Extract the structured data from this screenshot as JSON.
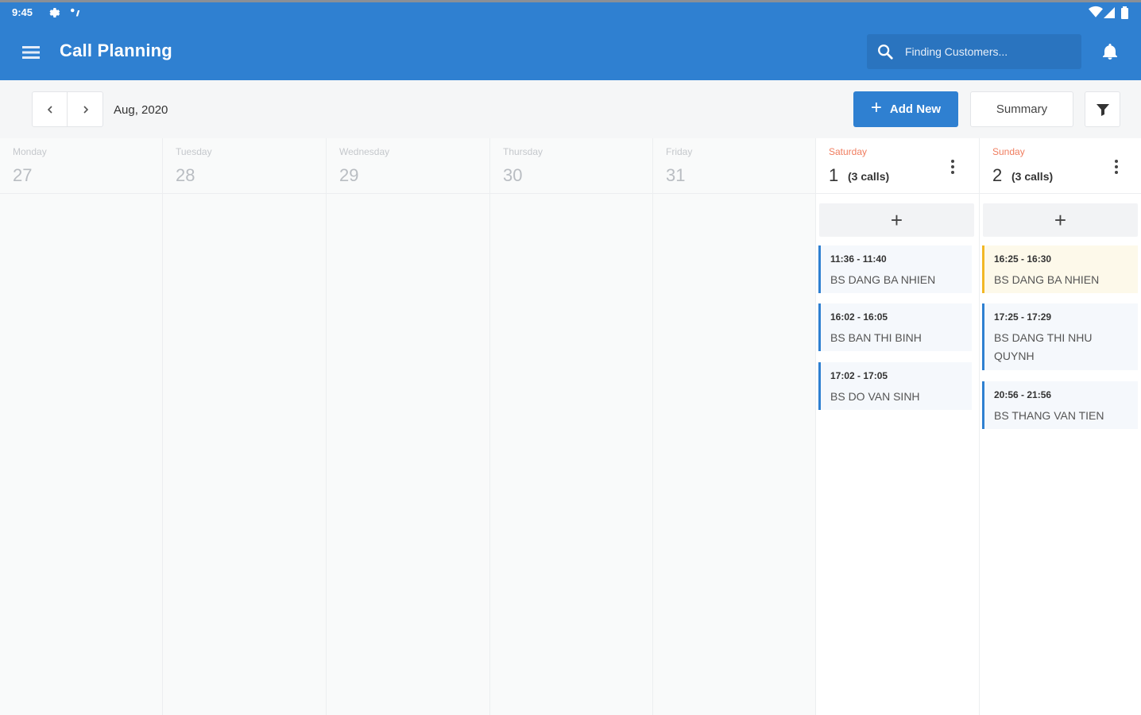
{
  "status_bar": {
    "time": "9:45"
  },
  "app_bar": {
    "title": "Call Planning",
    "search_placeholder": "Finding Customers..."
  },
  "toolbar": {
    "month": "Aug, 2020",
    "add_new_label": "Add New",
    "summary_label": "Summary"
  },
  "colors": {
    "primary": "#2f80d1",
    "weekend_label": "#f07d5f",
    "event_yellow_border": "#f2b826"
  },
  "days": [
    {
      "name": "Monday",
      "date": "27"
    },
    {
      "name": "Tuesday",
      "date": "28"
    },
    {
      "name": "Wednesday",
      "date": "29"
    },
    {
      "name": "Thursday",
      "date": "30"
    },
    {
      "name": "Friday",
      "date": "31"
    },
    {
      "name": "Saturday",
      "date": "1",
      "calls": "(3 calls)",
      "events": [
        {
          "time": "11:36 - 11:40",
          "name": "BS DANG BA NHIEN"
        },
        {
          "time": "16:02 - 16:05",
          "name": "BS BAN THI BINH"
        },
        {
          "time": "17:02 - 17:05",
          "name": "BS DO VAN SINH"
        }
      ]
    },
    {
      "name": "Sunday",
      "date": "2",
      "calls": "(3 calls)",
      "events": [
        {
          "time": "16:25 - 16:30",
          "name": "BS DANG BA NHIEN"
        },
        {
          "time": "17:25 - 17:29",
          "name": "BS DANG THI NHU QUYNH"
        },
        {
          "time": "20:56 - 21:56",
          "name": "BS THANG VAN TIEN"
        }
      ]
    }
  ]
}
